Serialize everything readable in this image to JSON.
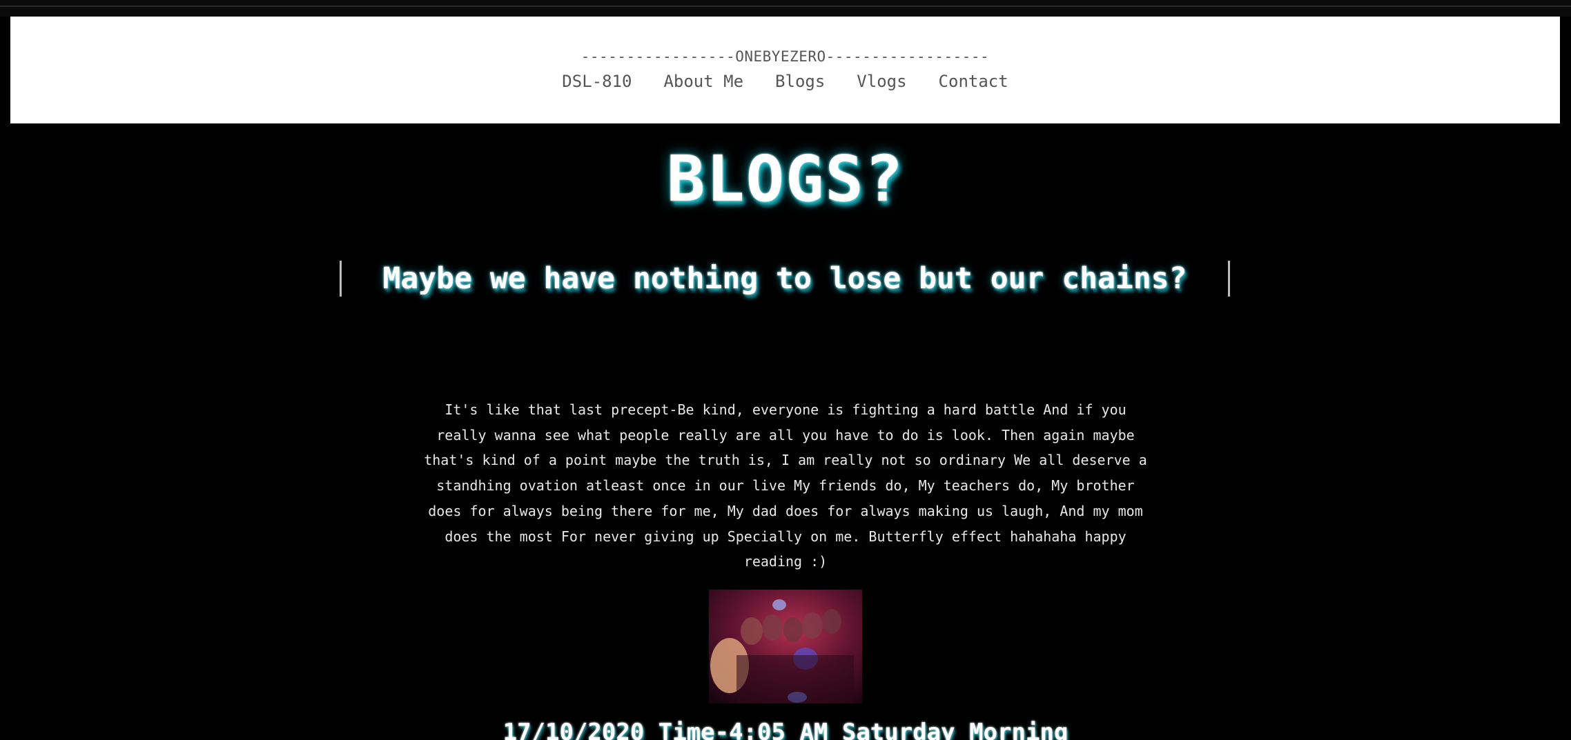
{
  "header": {
    "brand": "-----------------ONEBYEZERO------------------",
    "nav": [
      {
        "label": "DSL-810"
      },
      {
        "label": "About Me"
      },
      {
        "label": "Blogs"
      },
      {
        "label": "Vlogs"
      },
      {
        "label": "Contact"
      }
    ]
  },
  "page": {
    "heading": "BLOGS?",
    "quote": "Maybe we have nothing to lose but our chains?"
  },
  "post": {
    "text": "It's like that last precept-Be kind, everyone is fighting a hard battle And if you really wanna see what people really are all you have to do is look. Then again maybe that's kind of a point maybe the truth is, I am really not so ordinary We all deserve a standhing ovation atleast once in our live My friends do, My teachers do, My brother does for always being there for me, My dad does for always making us laugh, And my mom does the most For never giving up Specially on me. Butterfly effect hahahaha happy reading :)",
    "image_icon": "group-photo",
    "date": "17/10/2020  Time-4:05 AM   Saturday Morning"
  },
  "colors": {
    "background": "#000000",
    "header_bg": "#ffffff",
    "nav_text": "#555555",
    "heading_glow": "#16a7b3",
    "body_text": "#e8e8e8"
  }
}
